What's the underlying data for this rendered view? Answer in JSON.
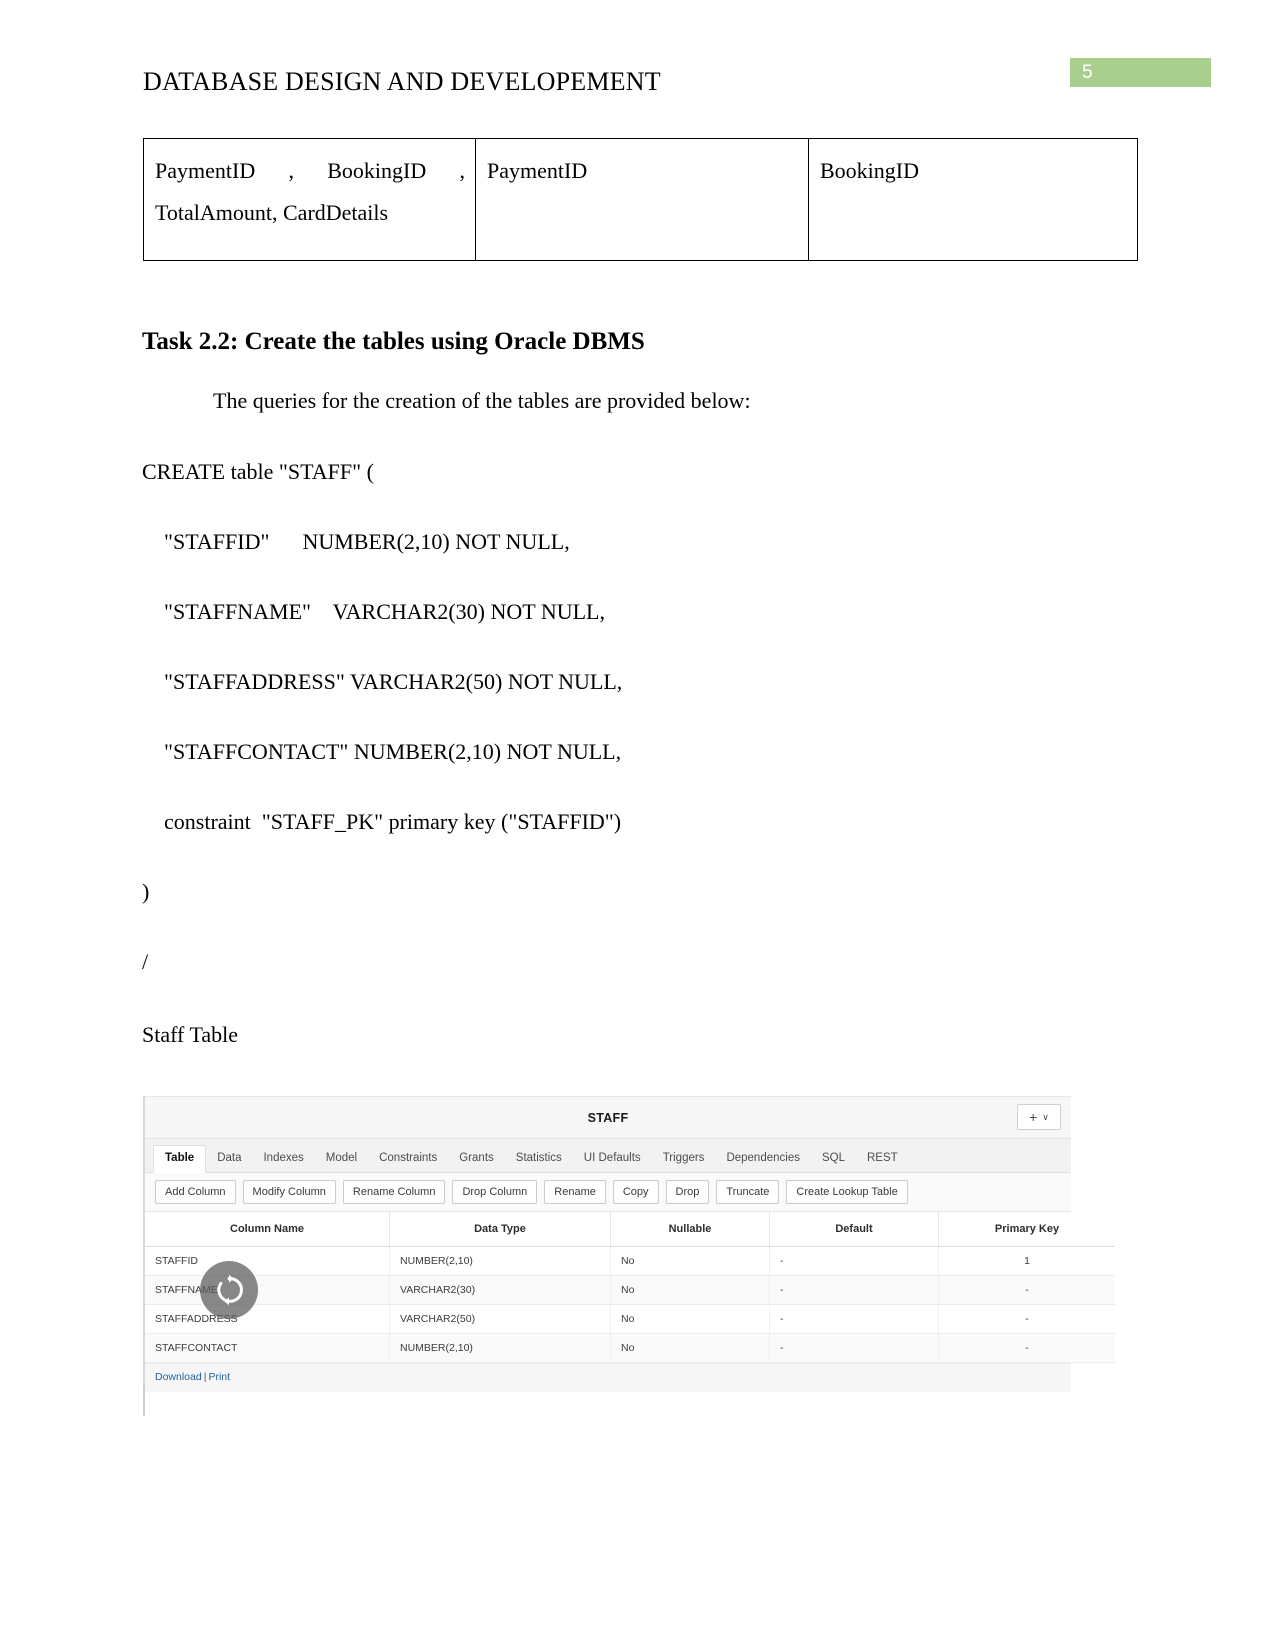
{
  "header": {
    "title": "DATABASE DESIGN AND DEVELOPEMENT",
    "page_number": "5",
    "badge_color": "#a9cf8f"
  },
  "top_table": {
    "cells": [
      {
        "line1": "PaymentID , BookingID ,",
        "line2": "TotalAmount, CardDetails"
      },
      {
        "line1": "PaymentID",
        "line2": ""
      },
      {
        "line1": "BookingID",
        "line2": ""
      }
    ]
  },
  "body": {
    "task_heading": "Task 2.2: Create the tables using Oracle DBMS",
    "intro": "The queries for the creation of the tables are provided below:",
    "sql_lines": [
      "CREATE table \"STAFF\" (",
      "\"STAFFID\"      NUMBER(2,10) NOT NULL,",
      "\"STAFFNAME\"    VARCHAR2(30) NOT NULL,",
      "\"STAFFADDRESS\" VARCHAR2(50) NOT NULL,",
      "\"STAFFCONTACT\" NUMBER(2,10) NOT NULL,",
      "constraint  \"STAFF_PK\" primary key (\"STAFFID\")",
      ")",
      "/"
    ],
    "caption": "Staff Table"
  },
  "apex": {
    "title": "STAFF",
    "add_button": {
      "plus": "+",
      "chevron": "∨"
    },
    "tabs": [
      {
        "label": "Table",
        "active": true
      },
      {
        "label": "Data",
        "active": false
      },
      {
        "label": "Indexes",
        "active": false
      },
      {
        "label": "Model",
        "active": false
      },
      {
        "label": "Constraints",
        "active": false
      },
      {
        "label": "Grants",
        "active": false
      },
      {
        "label": "Statistics",
        "active": false
      },
      {
        "label": "UI Defaults",
        "active": false
      },
      {
        "label": "Triggers",
        "active": false
      },
      {
        "label": "Dependencies",
        "active": false
      },
      {
        "label": "SQL",
        "active": false
      },
      {
        "label": "REST",
        "active": false
      }
    ],
    "toolbar": [
      "Add Column",
      "Modify Column",
      "Rename Column",
      "Drop Column",
      "Rename",
      "Copy",
      "Drop",
      "Truncate",
      "Create Lookup Table"
    ],
    "table": {
      "columns": [
        "Column Name",
        "Data Type",
        "Nullable",
        "Default",
        "Primary Key"
      ],
      "rows": [
        {
          "name": "STAFFID",
          "type": "NUMBER(2,10)",
          "nullable": "No",
          "default": "-",
          "pk": "1"
        },
        {
          "name": "STAFFNAME",
          "type": "VARCHAR2(30)",
          "nullable": "No",
          "default": "-",
          "pk": "-"
        },
        {
          "name": "STAFFADDRESS",
          "type": "VARCHAR2(50)",
          "nullable": "No",
          "default": "-",
          "pk": "-"
        },
        {
          "name": "STAFFCONTACT",
          "type": "NUMBER(2,10)",
          "nullable": "No",
          "default": "-",
          "pk": "-"
        }
      ]
    },
    "footer": {
      "download": "Download",
      "separator": "|",
      "print": "Print"
    }
  }
}
